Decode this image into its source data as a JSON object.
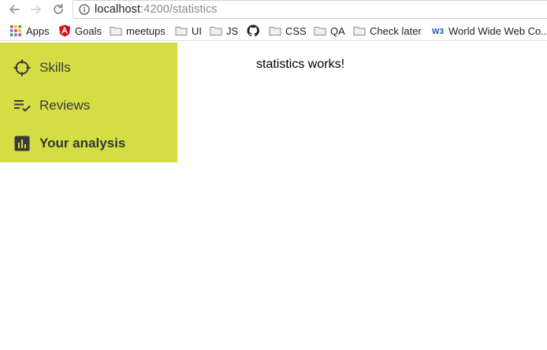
{
  "browser": {
    "url_host": "localhost",
    "url_rest": ":4200/statistics"
  },
  "bookmarks": [
    {
      "label": "Apps"
    },
    {
      "label": "Goals"
    },
    {
      "label": "meetups"
    },
    {
      "label": "UI"
    },
    {
      "label": "JS"
    },
    {
      "label": ""
    },
    {
      "label": "CSS"
    },
    {
      "label": "QA"
    },
    {
      "label": "Check later"
    },
    {
      "label": "World Wide Web Co..."
    }
  ],
  "sidebar": {
    "items": [
      {
        "label": "Skills",
        "icon": "crosshair-icon",
        "active": false
      },
      {
        "label": "Reviews",
        "icon": "playlist-check-icon",
        "active": false
      },
      {
        "label": "Your analysis",
        "icon": "bar-chart-icon",
        "active": true
      }
    ],
    "background": "#d4de44"
  },
  "main": {
    "message": "statistics works!"
  }
}
